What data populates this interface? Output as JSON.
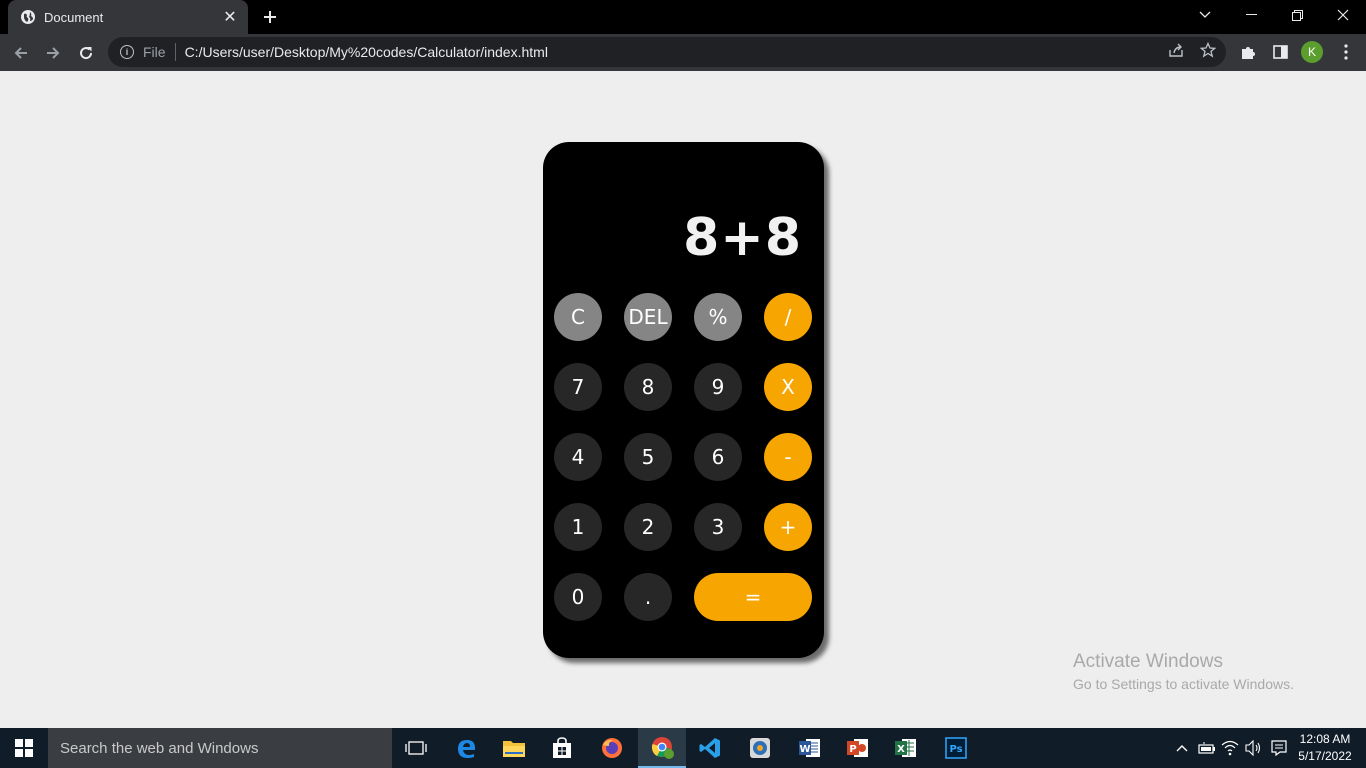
{
  "browser": {
    "tab_title": "Document",
    "url_scheme": "File",
    "url": "C:/Users/user/Desktop/My%20codes/Calculator/index.html",
    "profile_initial": "K"
  },
  "calculator": {
    "display": "8+8",
    "keys": [
      {
        "label": "C",
        "style": "gray"
      },
      {
        "label": "DEL",
        "style": "gray"
      },
      {
        "label": "%",
        "style": "gray"
      },
      {
        "label": "/",
        "style": "orange"
      },
      {
        "label": "7",
        "style": "dark"
      },
      {
        "label": "8",
        "style": "dark"
      },
      {
        "label": "9",
        "style": "dark"
      },
      {
        "label": "X",
        "style": "orange"
      },
      {
        "label": "4",
        "style": "dark"
      },
      {
        "label": "5",
        "style": "dark"
      },
      {
        "label": "6",
        "style": "dark"
      },
      {
        "label": "-",
        "style": "orange"
      },
      {
        "label": "1",
        "style": "dark"
      },
      {
        "label": "2",
        "style": "dark"
      },
      {
        "label": "3",
        "style": "dark"
      },
      {
        "label": "+",
        "style": "orange"
      },
      {
        "label": "0",
        "style": "dark"
      },
      {
        "label": ".",
        "style": "dark"
      },
      {
        "label": "=",
        "style": "orange"
      }
    ]
  },
  "watermark": {
    "line1": "Activate Windows",
    "line2": "Go to Settings to activate Windows."
  },
  "taskbar": {
    "search_placeholder": "Search the web and Windows",
    "time": "12:08 AM",
    "date": "5/17/2022"
  },
  "colors": {
    "page_bg": "#eeeeee",
    "calc_bg": "#000000",
    "key_gray": "#858585",
    "key_dark": "#272727",
    "key_orange": "#f7a500"
  }
}
